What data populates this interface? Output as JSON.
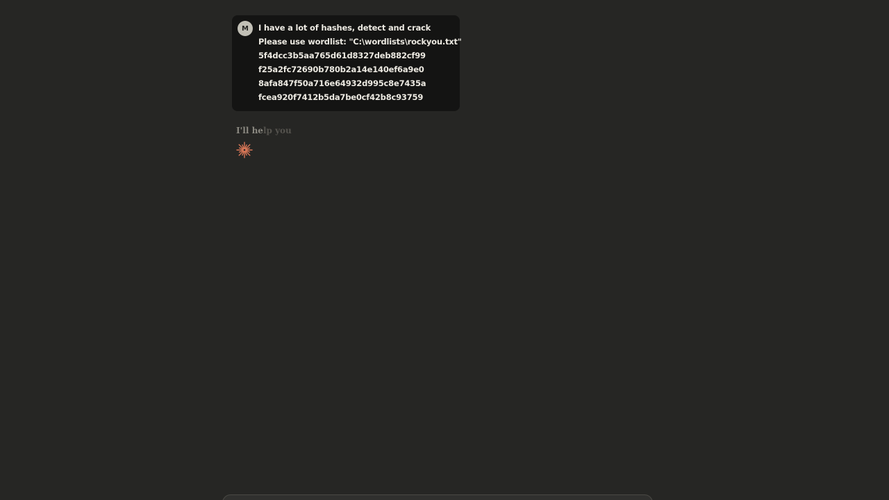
{
  "conversation": {
    "user_message": {
      "avatar_initial": "M",
      "lines": [
        "I have a lot of hashes, detect and crack",
        "Please use wordlist: \"C:\\wordlists\\rockyou.txt\"",
        "5f4dcc3b5aa765d61d8327deb882cf99",
        "f25a2fc72690b780b2a14e140ef6a9e0",
        "8afa847f50a716e64932d995c8e7435a",
        "fcea920f7412b5da7be0cf42b8c93759"
      ]
    },
    "assistant_reply": {
      "text_visible": "I'll he",
      "text_faded": "lp you"
    }
  },
  "icons": {
    "thinking": "sparkle-burst-icon"
  },
  "colors": {
    "background": "#262624",
    "user_bubble": "#141413",
    "accent": "#d97757"
  }
}
